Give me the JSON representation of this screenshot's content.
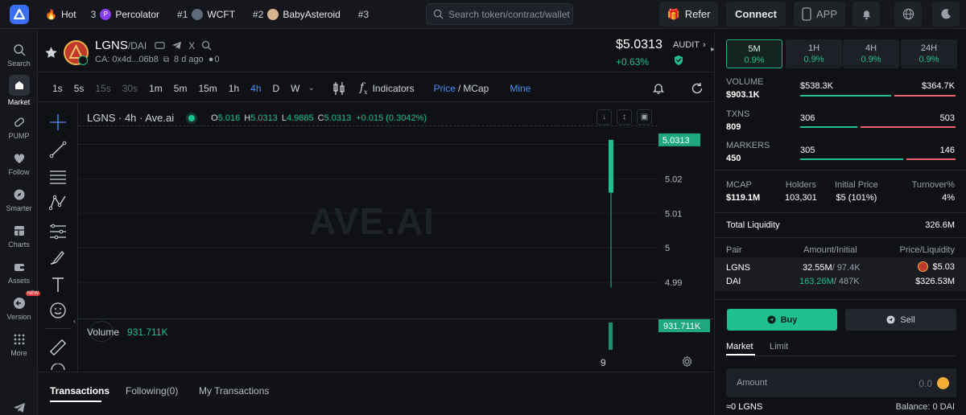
{
  "topbar": {
    "hot_label": "Hot",
    "trending": [
      {
        "rank": "3",
        "name": "Percolator"
      },
      {
        "rank": "#1",
        "name": "WCFT"
      },
      {
        "rank": "#2",
        "name": "BabyAsteroid"
      },
      {
        "rank": "#3",
        "name": ""
      }
    ],
    "search_placeholder": "Search token/contract/wallet",
    "refer_label": "Refer",
    "connect_label": "Connect",
    "app_label": "APP"
  },
  "sidebar": {
    "items": [
      {
        "label": "Search"
      },
      {
        "label": "Market"
      },
      {
        "label": "PUMP"
      },
      {
        "label": "Follow"
      },
      {
        "label": "Smarter"
      },
      {
        "label": "Charts"
      },
      {
        "label": "Assets"
      },
      {
        "label": "Version",
        "badge": "NEW"
      },
      {
        "label": "More"
      }
    ]
  },
  "token": {
    "symbol": "LGNS",
    "pair": "/DAI",
    "ca": "CA: 0x4d...06b8",
    "age": "8 d ago",
    "holders_mini": "0",
    "price": "$5.0313",
    "change": "+0.63%",
    "audit_label": "AUDIT"
  },
  "toolbar": {
    "timeframes": [
      "1s",
      "5s",
      "15s",
      "30s",
      "1m",
      "5m",
      "15m",
      "1h",
      "4h",
      "D",
      "W"
    ],
    "active_timeframe": "4h",
    "indicators_label": "Indicators",
    "price_label": "Price",
    "mcap_label": "MCap",
    "mine_label": "Mine"
  },
  "chart": {
    "title": "LGNS · 4h · Ave.ai",
    "ohlc": {
      "o_label": "O",
      "o": "5.016",
      "h_label": "H",
      "h": "5.0313",
      "l_label": "L",
      "l": "4.9885",
      "c_label": "C",
      "c": "5.0313",
      "change": "+0.015 (0.3042%)"
    },
    "watermark": "AVE.AI",
    "y_ticks": [
      "5.03",
      "5.02",
      "5.01",
      "5",
      "4.99"
    ],
    "last_price_tag": "5.0313",
    "volume_label": "Volume",
    "volume_value": "931.711K",
    "volume_tag": "931.711K",
    "x_label": "9"
  },
  "chart_data": {
    "type": "candlestick",
    "title": "LGNS · 4h · Ave.ai",
    "ylim": [
      4.98,
      5.035
    ],
    "candles": [
      {
        "x": "9",
        "o": 5.016,
        "h": 5.0313,
        "l": 4.9885,
        "c": 5.0313,
        "volume": 931711
      }
    ]
  },
  "bottom_tabs": [
    "Transactions",
    "Following(0)",
    "My Transactions"
  ],
  "right": {
    "periods": [
      {
        "label": "5M",
        "pct": "0.9%"
      },
      {
        "label": "1H",
        "pct": "0.9%"
      },
      {
        "label": "4H",
        "pct": "0.9%"
      },
      {
        "label": "24H",
        "pct": "0.9%"
      }
    ],
    "volume": {
      "label": "VOLUME",
      "total": "$903.1K",
      "buy": "$538.3K",
      "sell": "$364.7K",
      "buy_ratio": 0.596
    },
    "txns": {
      "label": "TXNS",
      "total": "809",
      "buy": "306",
      "sell": "503",
      "buy_ratio": 0.378
    },
    "makers": {
      "label": "MARKERS",
      "total": "450",
      "buy": "305",
      "sell": "146",
      "buy_ratio": 0.676
    },
    "stats": {
      "mcap_label": "MCAP",
      "mcap": "$119.1M",
      "holders_label": "Holders",
      "holders": "103,301",
      "initial_label": "Initial Price",
      "initial": "$5 (101%)",
      "turnover_label": "Turnover%",
      "turnover": "4%"
    },
    "liquidity": {
      "label": "Total Liquidity",
      "value": "326.6M"
    },
    "pair_table": {
      "headers": [
        "Pair",
        "Amount/Initial",
        "Price/Liquidity"
      ],
      "rows": [
        {
          "pair": "LGNS",
          "amount": "32.55M",
          "initial": "/ 97.4K",
          "price": "$5.03"
        },
        {
          "pair": "DAI",
          "amount": "163.26M",
          "initial": "/ 487K",
          "price": "$326.53M"
        }
      ]
    },
    "trade": {
      "buy_label": "Buy",
      "sell_label": "Sell",
      "market_tab": "Market",
      "limit_tab": "Limit",
      "amount_label": "Amount",
      "amount_value": "0.0",
      "receive": "≈0 LGNS",
      "balance": "Balance: 0 DAI"
    }
  }
}
